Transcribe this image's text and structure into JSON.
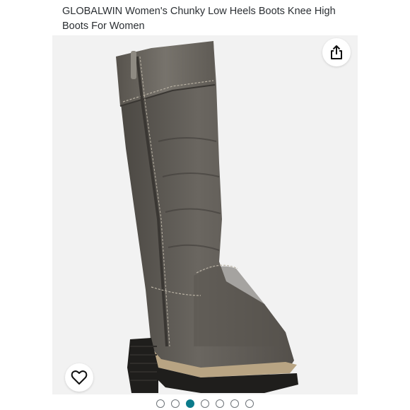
{
  "product": {
    "title": "GLOBALWIN Women's Chunky Low Heels Boots Knee High Boots For Women"
  },
  "actions": {
    "share_icon": "share-icon",
    "wishlist_icon": "heart-icon"
  },
  "carousel": {
    "total_images": 7,
    "active_index": 2,
    "active_color": "#0b7b8b"
  }
}
